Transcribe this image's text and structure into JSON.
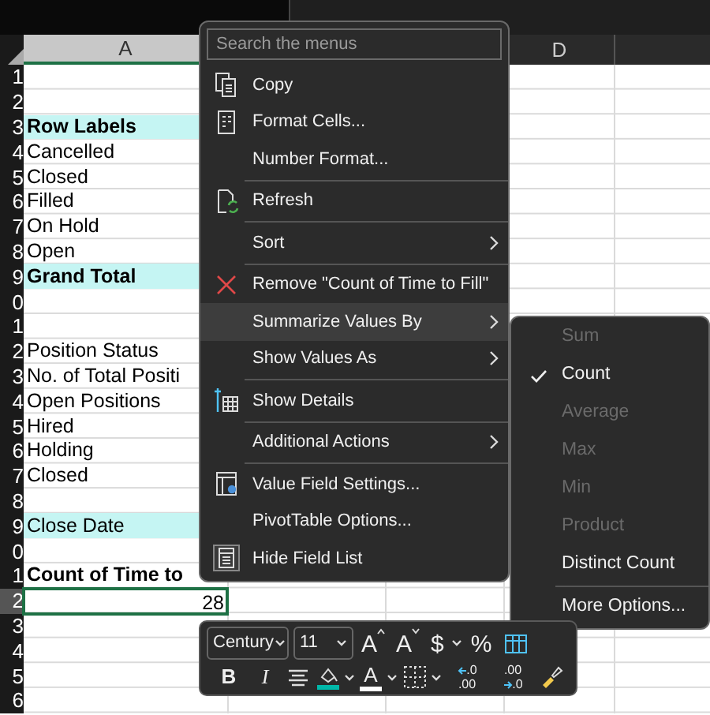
{
  "sheet": {
    "columns": [
      {
        "label": "A",
        "selected": true
      },
      {
        "label": "D",
        "selected": false
      }
    ],
    "rows": [
      {
        "number": "1",
        "kind": "blank"
      },
      {
        "number": "2",
        "kind": "blank"
      },
      {
        "number": "3",
        "kind": "header",
        "text": "Row Labels"
      },
      {
        "number": "4",
        "kind": "item",
        "text": "Cancelled"
      },
      {
        "number": "5",
        "kind": "item",
        "text": "Closed"
      },
      {
        "number": "6",
        "kind": "item",
        "text": "Filled"
      },
      {
        "number": "7",
        "kind": "item",
        "text": "On Hold"
      },
      {
        "number": "8",
        "kind": "item",
        "text": "Open"
      },
      {
        "number": "9",
        "kind": "header",
        "text": "Grand Total"
      },
      {
        "number": "0",
        "kind": "blank"
      },
      {
        "number": "1",
        "kind": "blank"
      },
      {
        "number": "2",
        "kind": "item",
        "text": "Position Status"
      },
      {
        "number": "3",
        "kind": "item",
        "text": "No. of Total Positi"
      },
      {
        "number": "4",
        "kind": "item",
        "text": "Open Positions"
      },
      {
        "number": "5",
        "kind": "item",
        "text": "Hired"
      },
      {
        "number": "6",
        "kind": "item",
        "text": "Holding"
      },
      {
        "number": "7",
        "kind": "item",
        "text": "Closed"
      },
      {
        "number": "8",
        "kind": "blank"
      },
      {
        "number": "9",
        "kind": "section",
        "text": "Close Date"
      },
      {
        "number": "0",
        "kind": "blank"
      },
      {
        "number": "1",
        "kind": "bold",
        "text": "Count of Time to"
      },
      {
        "number": "2",
        "kind": "value",
        "text": "28",
        "selected": true
      },
      {
        "number": "3",
        "kind": "blank"
      },
      {
        "number": "4",
        "kind": "blank"
      },
      {
        "number": "5",
        "kind": "blank"
      },
      {
        "number": "6",
        "kind": "blank"
      }
    ]
  },
  "context_menu": {
    "search": {
      "placeholder": "Search the menus"
    },
    "items": [
      {
        "kind": "copy",
        "label": "Copy",
        "submenu": false,
        "selected": false
      },
      {
        "kind": "format",
        "label": "Format Cells...",
        "submenu": false,
        "selected": false
      },
      {
        "kind": "plain",
        "label": "Number Format...",
        "submenu": false,
        "selected": false
      },
      {
        "kind": "separator"
      },
      {
        "kind": "refresh",
        "label": "Refresh",
        "submenu": false,
        "selected": false
      },
      {
        "kind": "separator"
      },
      {
        "kind": "plain",
        "label": "Sort",
        "submenu": true,
        "selected": false
      },
      {
        "kind": "separator"
      },
      {
        "kind": "remove",
        "label": "Remove \"Count of Time to Fill\"",
        "submenu": false,
        "selected": false
      },
      {
        "kind": "plain",
        "label": "Summarize Values By",
        "submenu": true,
        "selected": true
      },
      {
        "kind": "plain",
        "label": "Show Values As",
        "submenu": true,
        "selected": false
      },
      {
        "kind": "separator"
      },
      {
        "kind": "details",
        "label": "Show Details",
        "submenu": false,
        "selected": false
      },
      {
        "kind": "separator"
      },
      {
        "kind": "plain",
        "label": "Additional Actions",
        "submenu": true,
        "selected": false
      },
      {
        "kind": "separator"
      },
      {
        "kind": "settings",
        "label": "Value Field Settings...",
        "submenu": false,
        "selected": false
      },
      {
        "kind": "plain",
        "label": "PivotTable Options...",
        "submenu": false,
        "selected": false
      },
      {
        "kind": "fieldlist",
        "label": "Hide Field List",
        "submenu": false,
        "selected": false
      }
    ]
  },
  "submenu": {
    "items": [
      {
        "kind": "item",
        "label": "Sum",
        "checked": false,
        "disabled": true
      },
      {
        "kind": "item",
        "label": "Count",
        "checked": true,
        "disabled": false
      },
      {
        "kind": "item",
        "label": "Average",
        "checked": false,
        "disabled": true
      },
      {
        "kind": "item",
        "label": "Max",
        "checked": false,
        "disabled": true
      },
      {
        "kind": "item",
        "label": "Min",
        "checked": false,
        "disabled": true
      },
      {
        "kind": "item",
        "label": "Product",
        "checked": false,
        "disabled": true
      },
      {
        "kind": "item",
        "label": "Distinct Count",
        "checked": false,
        "disabled": false
      },
      {
        "kind": "separator"
      },
      {
        "kind": "item",
        "label": "More Options...",
        "checked": false,
        "disabled": false
      }
    ]
  },
  "mini_toolbar": {
    "font": "Century",
    "size": "11",
    "row_1": [
      {
        "kind": "grow",
        "label": "A"
      },
      {
        "kind": "shrink",
        "label": "A"
      },
      {
        "kind": "currency",
        "label": "$"
      },
      {
        "kind": "percent",
        "label": "%"
      },
      {
        "kind": "table"
      }
    ],
    "row_2": [
      {
        "kind": "bold",
        "label": "B"
      },
      {
        "kind": "italic",
        "label": "I"
      },
      {
        "kind": "align"
      },
      {
        "kind": "fill"
      },
      {
        "kind": "fontcolor",
        "label": "A"
      },
      {
        "kind": "borders"
      },
      {
        "kind": "decrease",
        "top": ".0",
        "bottom": ".00"
      },
      {
        "kind": "increase",
        "top": ".00",
        "bottom": ".0"
      },
      {
        "kind": "brush"
      }
    ]
  }
}
